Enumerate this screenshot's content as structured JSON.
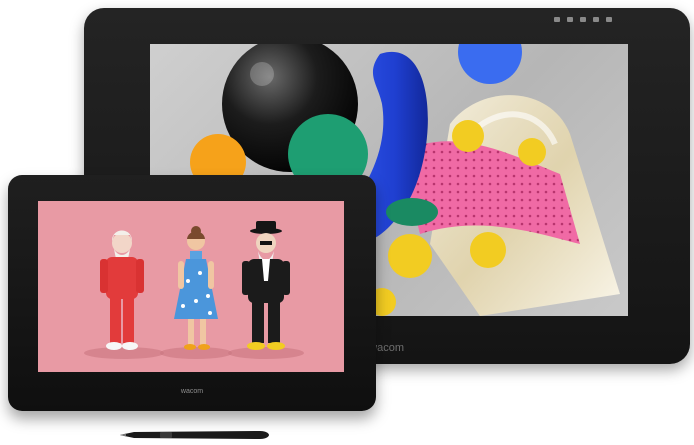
{
  "tablet_large": {
    "brand": "wacom"
  },
  "tablet_small": {
    "brand": "wacom"
  },
  "colors": {
    "bezel": "#1b1b1b",
    "large_screen_bg": "#c4c4c4",
    "small_screen_bg": "#e89aa4",
    "blue_ring": "#1f3fd0",
    "pink_strip": "#f06aa5",
    "yellow": "#f2cc22",
    "green": "#1e9e72",
    "orange": "#f6a21a"
  }
}
